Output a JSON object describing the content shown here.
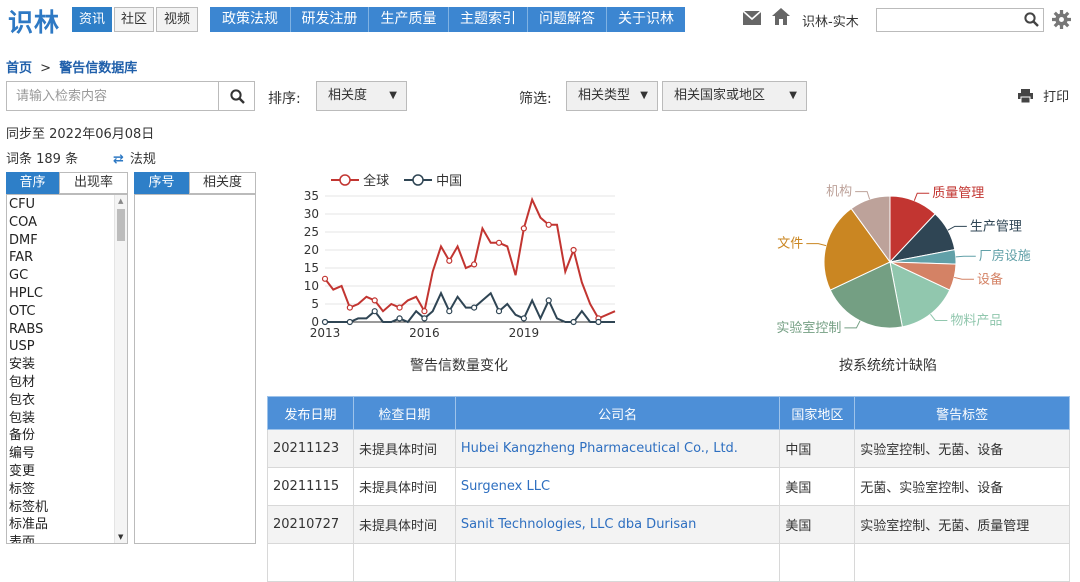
{
  "header": {
    "logo": "识林",
    "tabs": [
      "资讯",
      "社区",
      "视频"
    ],
    "nav": [
      "政策法规",
      "研发注册",
      "生产质量",
      "主题索引",
      "问题解答",
      "关于识林"
    ],
    "user": "识林-实木",
    "search_value": ""
  },
  "breadcrumb": {
    "home": "首页",
    "sep": ">",
    "current": "警告信数据库"
  },
  "search": {
    "placeholder": "请输入检索内容"
  },
  "sort": {
    "label": "排序:",
    "value": "相关度"
  },
  "filter": {
    "label": "筛选:",
    "type": "相关类型",
    "region": "相关国家或地区"
  },
  "print_label": "打印",
  "sync_text": "同步至 2022年06月08日",
  "count_text": "词条 189 条",
  "law_link": "法规",
  "left_tabs": [
    "音序",
    "出现率"
  ],
  "right_tabs": [
    "序号",
    "相关度"
  ],
  "terms": [
    "CFU",
    "COA",
    "DMF",
    "FAR",
    "GC",
    "HPLC",
    "OTC",
    "RABS",
    "USP",
    "安装",
    "包材",
    "包衣",
    "包装",
    "备份",
    "编号",
    "变更",
    "标签",
    "标签机",
    "标准品",
    "表面"
  ],
  "chart_data": [
    {
      "type": "line",
      "title": "警告信数量变化",
      "legend": [
        "全球",
        "中国"
      ],
      "legend_position": "top",
      "x_ticks": [
        "2013",
        "2016",
        "2019"
      ],
      "y_ticks": [
        0,
        5,
        10,
        15,
        20,
        25,
        30,
        35
      ],
      "ylim": [
        0,
        35
      ],
      "x_count": 36,
      "series": [
        {
          "name": "全球",
          "color": "#c23531",
          "values": [
            12,
            9,
            10,
            4,
            5,
            7,
            6,
            3,
            5,
            4,
            6,
            7,
            3,
            14,
            21,
            17,
            21,
            15,
            16,
            26,
            22,
            22,
            21,
            13,
            26,
            34,
            29,
            27,
            27,
            14,
            20,
            11,
            5,
            1,
            2,
            3
          ]
        },
        {
          "name": "中国",
          "color": "#2f4554",
          "values": [
            0,
            0,
            0,
            0,
            1,
            1,
            3,
            0,
            0,
            1,
            0,
            3,
            1,
            3,
            8,
            3,
            7,
            4,
            4,
            6,
            8,
            3,
            5,
            2,
            1,
            6,
            1,
            6,
            1,
            0,
            0,
            3,
            0,
            0,
            0,
            0
          ]
        }
      ]
    },
    {
      "type": "pie",
      "title": "按系统统计缺陷",
      "series": [
        {
          "name": "质量管理",
          "value": 12.0,
          "color": "#c23531"
        },
        {
          "name": "生产管理",
          "value": 10.0,
          "color": "#2f4554"
        },
        {
          "name": "厂房设施",
          "value": 3.5,
          "color": "#61a0a8"
        },
        {
          "name": "设备",
          "value": 6.5,
          "color": "#d48265"
        },
        {
          "name": "物料产品",
          "value": 15.0,
          "color": "#91c7ae"
        },
        {
          "name": "实验室控制",
          "value": 21.0,
          "color": "#749f83"
        },
        {
          "name": "文件",
          "value": 22.0,
          "color": "#ca8622"
        },
        {
          "name": "机构",
          "value": 10.0,
          "color": "#bda29a"
        }
      ]
    }
  ],
  "table": {
    "headers": [
      "发布日期",
      "检查日期",
      "公司名",
      "国家地区",
      "警告标签"
    ],
    "rows": [
      [
        "20211123",
        "未提具体时间",
        "Hubei Kangzheng Pharmaceutical Co., Ltd.",
        "中国",
        "实验室控制、无菌、设备"
      ],
      [
        "20211115",
        "未提具体时间",
        "Surgenex LLC",
        "美国",
        "无菌、实验室控制、设备"
      ],
      [
        "20210727",
        "未提具体时间",
        "Sanit Technologies, LLC dba Durisan",
        "美国",
        "实验室控制、无菌、质量管理"
      ]
    ]
  }
}
